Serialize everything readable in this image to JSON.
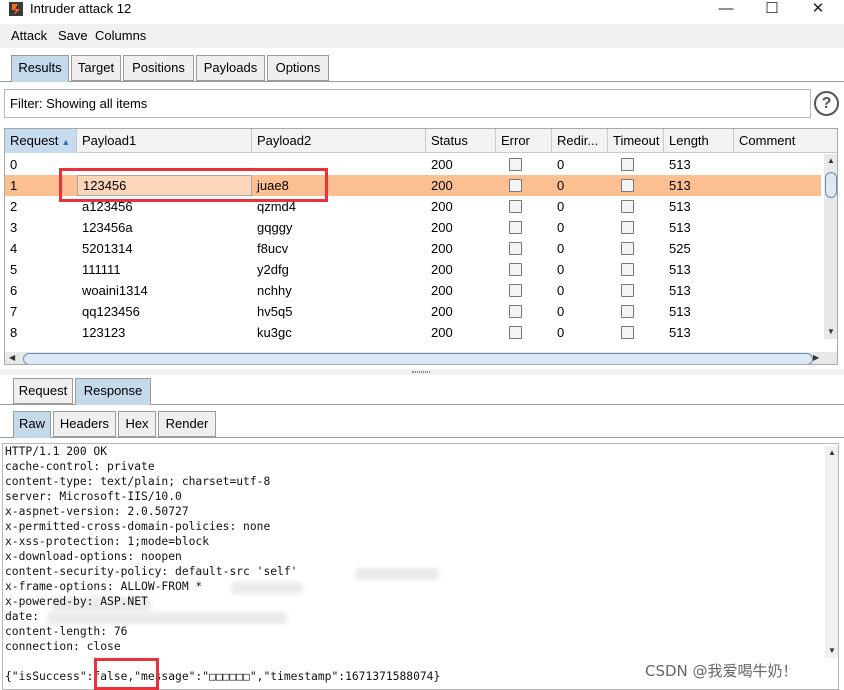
{
  "window": {
    "title": "Intruder attack 12",
    "min_glyph": "—",
    "max_glyph": "☐",
    "close_glyph": "✕"
  },
  "menu": [
    "Attack",
    "Save",
    "Columns"
  ],
  "main_tabs": [
    {
      "label": "Results",
      "active": true
    },
    {
      "label": "Target",
      "active": false
    },
    {
      "label": "Positions",
      "active": false
    },
    {
      "label": "Payloads",
      "active": false
    },
    {
      "label": "Options",
      "active": false
    }
  ],
  "filter": {
    "text": "Filter: Showing all items",
    "help_glyph": "?"
  },
  "table": {
    "columns": [
      "Request",
      "Payload1",
      "Payload2",
      "Status",
      "Error",
      "Redir...",
      "Timeout",
      "Length",
      "Comment"
    ],
    "sort_column": "Request",
    "sort_glyph": "▲",
    "rows": [
      {
        "request": "0",
        "payload1": "",
        "payload2": "",
        "status": "200",
        "error": false,
        "redir": "0",
        "timeout": false,
        "length": "513",
        "comment": ""
      },
      {
        "request": "1",
        "payload1": "123456",
        "payload2": "juae8",
        "status": "200",
        "error": false,
        "redir": "0",
        "timeout": false,
        "length": "513",
        "comment": "",
        "selected": true
      },
      {
        "request": "2",
        "payload1": "a123456",
        "payload2": "qzmd4",
        "status": "200",
        "error": false,
        "redir": "0",
        "timeout": false,
        "length": "513",
        "comment": ""
      },
      {
        "request": "3",
        "payload1": "123456a",
        "payload2": "gqggy",
        "status": "200",
        "error": false,
        "redir": "0",
        "timeout": false,
        "length": "513",
        "comment": ""
      },
      {
        "request": "4",
        "payload1": "5201314",
        "payload2": "f8ucv",
        "status": "200",
        "error": false,
        "redir": "0",
        "timeout": false,
        "length": "525",
        "comment": ""
      },
      {
        "request": "5",
        "payload1": "111111",
        "payload2": "y2dfg",
        "status": "200",
        "error": false,
        "redir": "0",
        "timeout": false,
        "length": "513",
        "comment": ""
      },
      {
        "request": "6",
        "payload1": "woaini1314",
        "payload2": "nchhy",
        "status": "200",
        "error": false,
        "redir": "0",
        "timeout": false,
        "length": "513",
        "comment": ""
      },
      {
        "request": "7",
        "payload1": "qq123456",
        "payload2": "hv5q5",
        "status": "200",
        "error": false,
        "redir": "0",
        "timeout": false,
        "length": "513",
        "comment": ""
      },
      {
        "request": "8",
        "payload1": "123123",
        "payload2": "ku3gc",
        "status": "200",
        "error": false,
        "redir": "0",
        "timeout": false,
        "length": "513",
        "comment": ""
      }
    ]
  },
  "detail_tabs": [
    {
      "label": "Request",
      "active": false
    },
    {
      "label": "Response",
      "active": true
    }
  ],
  "view_tabs": [
    {
      "label": "Raw",
      "active": true
    },
    {
      "label": "Headers",
      "active": false
    },
    {
      "label": "Hex",
      "active": false
    },
    {
      "label": "Render",
      "active": false
    }
  ],
  "response": {
    "lines": [
      "HTTP/1.1 200 OK",
      "cache-control: private",
      "content-type: text/plain; charset=utf-8",
      "server: Microsoft-IIS/10.0",
      "x-aspnet-version: 2.0.50727",
      "x-permitted-cross-domain-policies: none",
      "x-xss-protection: 1;mode=block",
      "x-download-options: noopen",
      "content-security-policy: default-src 'self'",
      "x-frame-options: ALLOW-FROM *",
      "x-powered-by: ASP.NET",
      "date:",
      "content-length: 76",
      "connection: close",
      "",
      "{\"isSuccess\":false,\"message\":\"□□□□□□\",\"timestamp\":1671371588074}"
    ]
  },
  "watermark": "CSDN @我爱喝牛奶！",
  "colors": {
    "selected_row": "#fbbf92",
    "active_tab": "#c4d9ea",
    "highlight_box": "#e8333a"
  }
}
